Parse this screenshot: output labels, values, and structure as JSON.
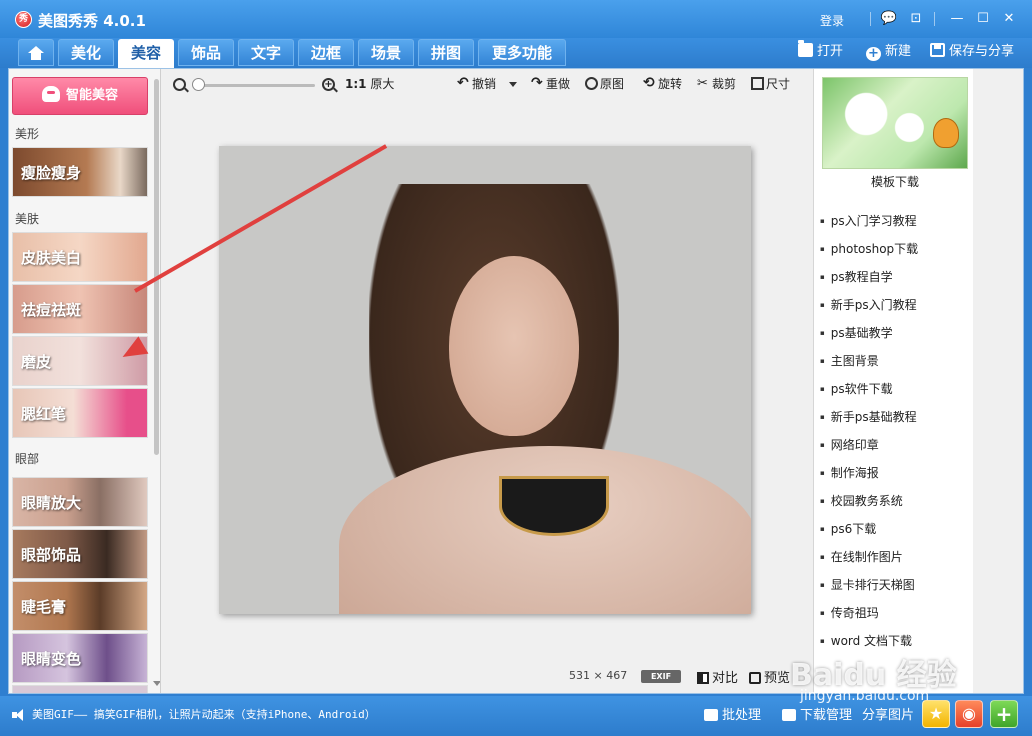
{
  "app": {
    "title": "美图秀秀 4.0.1",
    "logo_text": "秀",
    "login": "登录"
  },
  "window": {
    "chat": "💬",
    "menu": "⊡",
    "minimize": "—",
    "maximize": "☐",
    "close": "✕"
  },
  "tabs": [
    {
      "label": "美化"
    },
    {
      "label": "美容"
    },
    {
      "label": "饰品"
    },
    {
      "label": "文字"
    },
    {
      "label": "边框"
    },
    {
      "label": "场景"
    },
    {
      "label": "拼图"
    },
    {
      "label": "更多功能"
    }
  ],
  "actions": {
    "open": "打开",
    "new": "新建",
    "save_share": "保存与分享"
  },
  "left": {
    "smart_beauty": "智能美容",
    "sections": {
      "shape": "美形",
      "skin": "美肤",
      "eyes": "眼部"
    },
    "features": [
      "瘦脸瘦身",
      "皮肤美白",
      "祛痘祛斑",
      "磨皮",
      "腮红笔",
      "眼睛放大",
      "眼部饰品",
      "睫毛膏",
      "眼睛变色"
    ]
  },
  "toolbar": {
    "zoom_level": 0.0,
    "actual_size_prefix": "1:1",
    "actual_size": "原大",
    "undo": "撤销",
    "redo": "重做",
    "original": "原图",
    "rotate": "旋转",
    "crop": "裁剪",
    "size": "尺寸"
  },
  "canvas": {
    "width": "531",
    "times": "×",
    "height": "467",
    "exif": "EXIF",
    "compare": "对比",
    "preview": "预览"
  },
  "right": {
    "template_label": "模板下载",
    "links": [
      "ps入门学习教程",
      "photoshop下载",
      "ps教程自学",
      "新手ps入门教程",
      "ps基础教学",
      "主图背景",
      "ps软件下载",
      "新手ps基础教程",
      "网络印章",
      "制作海报",
      "校园教务系统",
      "ps6下载",
      "在线制作图片",
      "显卡排行天梯图",
      "传奇祖玛",
      "word 文档下载"
    ]
  },
  "status": {
    "text": "美图GIF—— 搞笑GIF相机，让照片动起来（支持iPhone、Android）",
    "batch": "批处理",
    "download": "下载管理",
    "share": "分享图片",
    "add": "+"
  },
  "watermark": {
    "main": "Baidu 经验",
    "sub": "jingyan.baidu.com"
  }
}
